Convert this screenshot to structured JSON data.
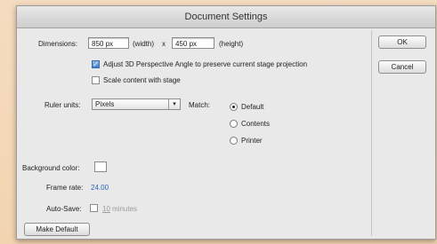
{
  "window": {
    "title": "Document Settings"
  },
  "dimensions": {
    "label": "Dimensions:",
    "width_value": "850 px",
    "width_label": "(width)",
    "times": "x",
    "height_value": "450 px",
    "height_label": "(height)"
  },
  "adjust_3d": {
    "label": "Adjust 3D Perspective Angle to preserve current stage projection",
    "checked": true
  },
  "scale_content": {
    "label": "Scale content with stage",
    "checked": false
  },
  "ruler": {
    "label": "Ruler units:",
    "value": "Pixels"
  },
  "match": {
    "label": "Match:",
    "options": [
      {
        "label": "Default",
        "selected": true
      },
      {
        "label": "Contents",
        "selected": false
      },
      {
        "label": "Printer",
        "selected": false
      }
    ]
  },
  "background_color": {
    "label": "Background color:",
    "color": "#ffffff"
  },
  "frame_rate": {
    "label": "Frame rate:",
    "value": "24.00"
  },
  "autosave": {
    "label": "Auto-Save:",
    "value": "10",
    "unit": "minutes",
    "checked": false
  },
  "buttons": {
    "make_default": "Make Default",
    "ok": "OK",
    "cancel": "Cancel"
  }
}
